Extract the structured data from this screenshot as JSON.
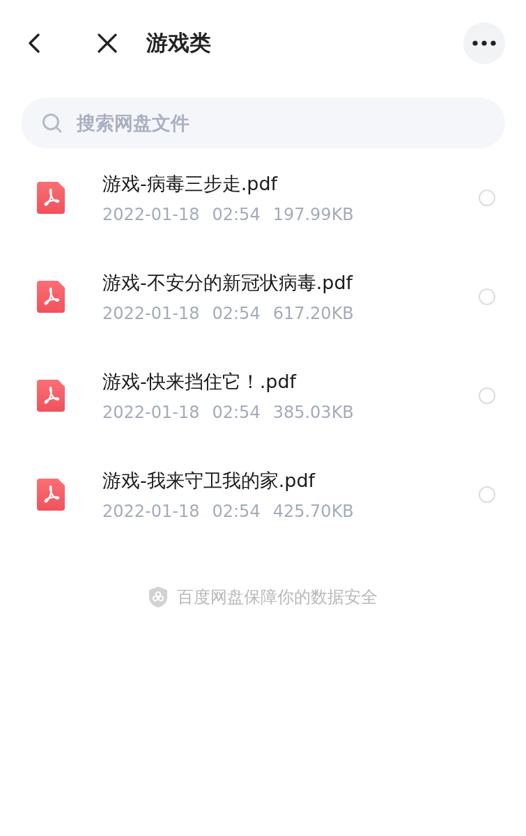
{
  "header": {
    "title": "游戏类"
  },
  "search": {
    "placeholder": "搜索网盘文件"
  },
  "files": [
    {
      "name": "游戏-病毒三步走.pdf",
      "date": "2022-01-18",
      "time": "02:54",
      "size": "197.99KB",
      "kind": "pdf",
      "selected": false
    },
    {
      "name": "游戏-不安分的新冠状病毒.pdf",
      "date": "2022-01-18",
      "time": "02:54",
      "size": "617.20KB",
      "kind": "pdf",
      "selected": false
    },
    {
      "name": "游戏-快来挡住它！.pdf",
      "date": "2022-01-18",
      "time": "02:54",
      "size": "385.03KB",
      "kind": "pdf",
      "selected": false
    },
    {
      "name": "游戏-我来守卫我的家.pdf",
      "date": "2022-01-18",
      "time": "02:54",
      "size": "425.70KB",
      "kind": "pdf",
      "selected": false
    }
  ],
  "footer": {
    "notice": "百度网盘保障你的数据安全"
  }
}
